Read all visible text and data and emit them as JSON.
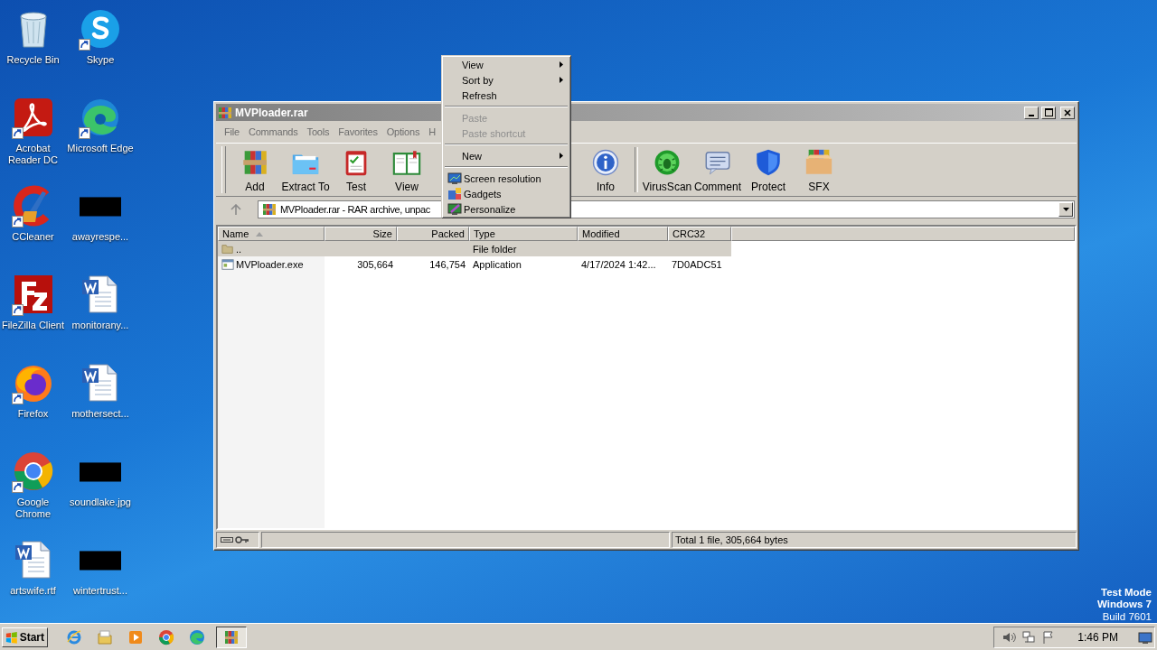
{
  "desktop_icons": [
    {
      "label": "Recycle Bin",
      "kind": "recycle",
      "shortcut": false
    },
    {
      "label": "Skype",
      "kind": "skype",
      "shortcut": true
    },
    {
      "label": "Acrobat Reader DC",
      "kind": "acrobat",
      "shortcut": true
    },
    {
      "label": "Microsoft Edge",
      "kind": "edge",
      "shortcut": true
    },
    {
      "label": "CCleaner",
      "kind": "ccleaner",
      "shortcut": true
    },
    {
      "label": "awayrespe...",
      "kind": "blank",
      "shortcut": false
    },
    {
      "label": "FileZilla Client",
      "kind": "filezilla",
      "shortcut": true
    },
    {
      "label": "monitorany...",
      "kind": "word",
      "shortcut": false
    },
    {
      "label": "Firefox",
      "kind": "firefox",
      "shortcut": true
    },
    {
      "label": "mothersect...",
      "kind": "word",
      "shortcut": false
    },
    {
      "label": "Google Chrome",
      "kind": "chrome",
      "shortcut": true
    },
    {
      "label": "soundlake.jpg",
      "kind": "blank",
      "shortcut": false
    },
    {
      "label": "artswife.rtf",
      "kind": "word",
      "shortcut": false
    },
    {
      "label": "wintertrust...",
      "kind": "blank",
      "shortcut": false
    }
  ],
  "window": {
    "title": "MVPloader.rar",
    "menu": [
      "File",
      "Commands",
      "Tools",
      "Favorites",
      "Options",
      "H"
    ],
    "toolbar": [
      {
        "label": "Add",
        "kind": "add"
      },
      {
        "label": "Extract To",
        "kind": "extract"
      },
      {
        "label": "Test",
        "kind": "test"
      },
      {
        "label": "View",
        "kind": "view"
      },
      {
        "label": "Info",
        "kind": "info"
      },
      {
        "label": "VirusScan",
        "kind": "virus"
      },
      {
        "label": "Comment",
        "kind": "comment"
      },
      {
        "label": "Protect",
        "kind": "protect"
      },
      {
        "label": "SFX",
        "kind": "sfx"
      }
    ],
    "address": "MVPloader.rar - RAR archive, unpac",
    "columns": [
      {
        "label": "Name",
        "kind": "text",
        "sorted": true
      },
      {
        "label": "Size",
        "kind": "number",
        "sorted": false
      },
      {
        "label": "Packed",
        "kind": "number",
        "sorted": false
      },
      {
        "label": "Type",
        "kind": "text",
        "sorted": false
      },
      {
        "label": "Modified",
        "kind": "text",
        "sorted": false
      },
      {
        "label": "CRC32",
        "kind": "text",
        "sorted": false
      }
    ],
    "rows": [
      {
        "kind": "folder",
        "selected": true,
        "cells": [
          "..",
          "",
          "",
          "File folder",
          "",
          ""
        ]
      },
      {
        "kind": "exe",
        "selected": false,
        "cells": [
          "MVPloader.exe",
          "305,664",
          "146,754",
          "Application",
          "4/17/2024 1:42...",
          "7D0ADC51"
        ]
      }
    ],
    "status": "Total 1 file, 305,664 bytes"
  },
  "context_menu": [
    {
      "kind": "item",
      "label": "View",
      "submenu": true,
      "disabled": false
    },
    {
      "kind": "item",
      "label": "Sort by",
      "submenu": true,
      "disabled": false
    },
    {
      "kind": "item",
      "label": "Refresh",
      "submenu": false,
      "disabled": false
    },
    {
      "kind": "separator"
    },
    {
      "kind": "item",
      "label": "Paste",
      "submenu": false,
      "disabled": true
    },
    {
      "kind": "item",
      "label": "Paste shortcut",
      "submenu": false,
      "disabled": true
    },
    {
      "kind": "separator"
    },
    {
      "kind": "item",
      "label": "New",
      "submenu": true,
      "disabled": false
    },
    {
      "kind": "separator"
    },
    {
      "kind": "icon-item",
      "label": "Screen resolution",
      "submenu": false,
      "disabled": false
    },
    {
      "kind": "icon-item",
      "label": "Gadgets",
      "submenu": false,
      "disabled": false
    },
    {
      "kind": "icon-item",
      "label": "Personalize",
      "submenu": false,
      "disabled": false
    }
  ],
  "taskbar": {
    "start": "Start",
    "apps": [
      {
        "kind": "ie",
        "selected": false
      },
      {
        "kind": "explorer",
        "selected": false
      },
      {
        "kind": "media",
        "selected": false
      },
      {
        "kind": "chrome",
        "selected": false
      },
      {
        "kind": "edge",
        "selected": false
      },
      {
        "kind": "winrar",
        "selected": true
      }
    ],
    "clock": "1:46 PM"
  },
  "system_notice": [
    "Test Mode",
    "Windows 7",
    "Build 7601"
  ]
}
